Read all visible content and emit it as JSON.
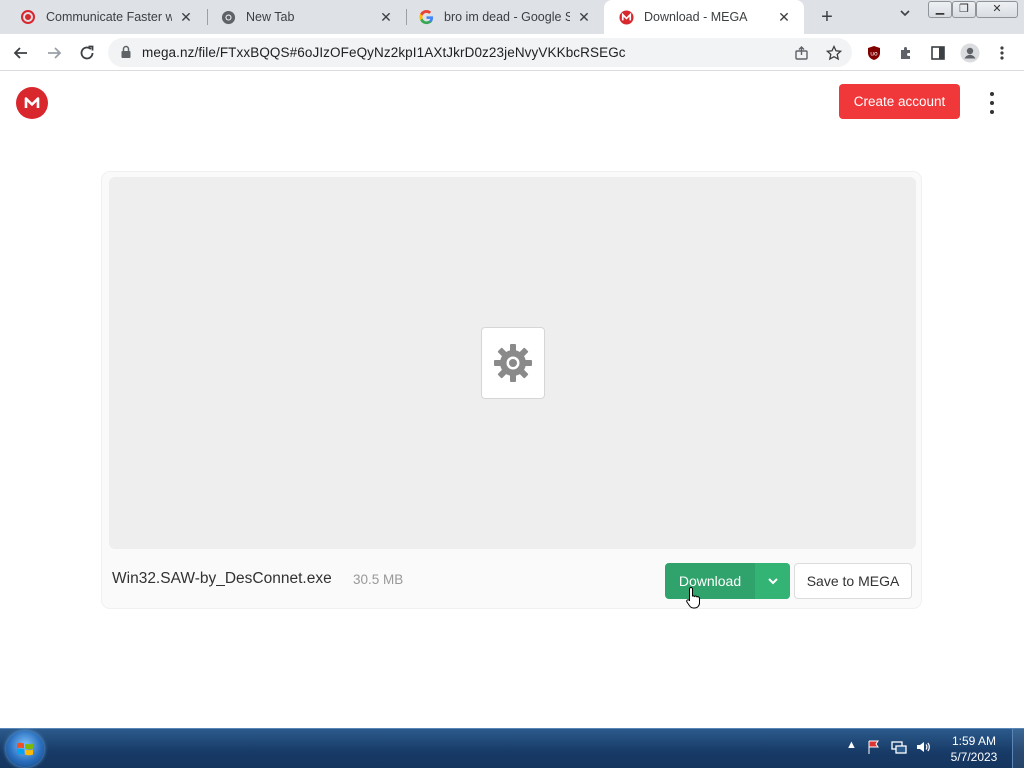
{
  "browser": {
    "tabs": [
      {
        "title": "Communicate Faster with",
        "icon": "opera-record-icon"
      },
      {
        "title": "New Tab",
        "icon": "chrome-icon"
      },
      {
        "title": "bro im dead - Google Se",
        "icon": "google-icon"
      },
      {
        "title": "Download - MEGA",
        "icon": "mega-icon"
      }
    ],
    "url": "mega.nz/file/FTxxBQQS#6oJIzOFeQyNz2kpI1AXtJkrD0z23jeNvyVKKbcRSEGc"
  },
  "page": {
    "header": {
      "create_account_label": "Create account"
    },
    "file": {
      "name": "Win32.SAW-by_DesConnet.exe",
      "size": "30.5 MB",
      "download_label": "Download",
      "save_label": "Save to MEGA"
    }
  },
  "taskbar": {
    "time": "1:59 AM",
    "date": "5/7/2023"
  },
  "colors": {
    "mega_red": "#d9272e",
    "create_button": "#f0373a",
    "download_green": "#2fa36b"
  }
}
